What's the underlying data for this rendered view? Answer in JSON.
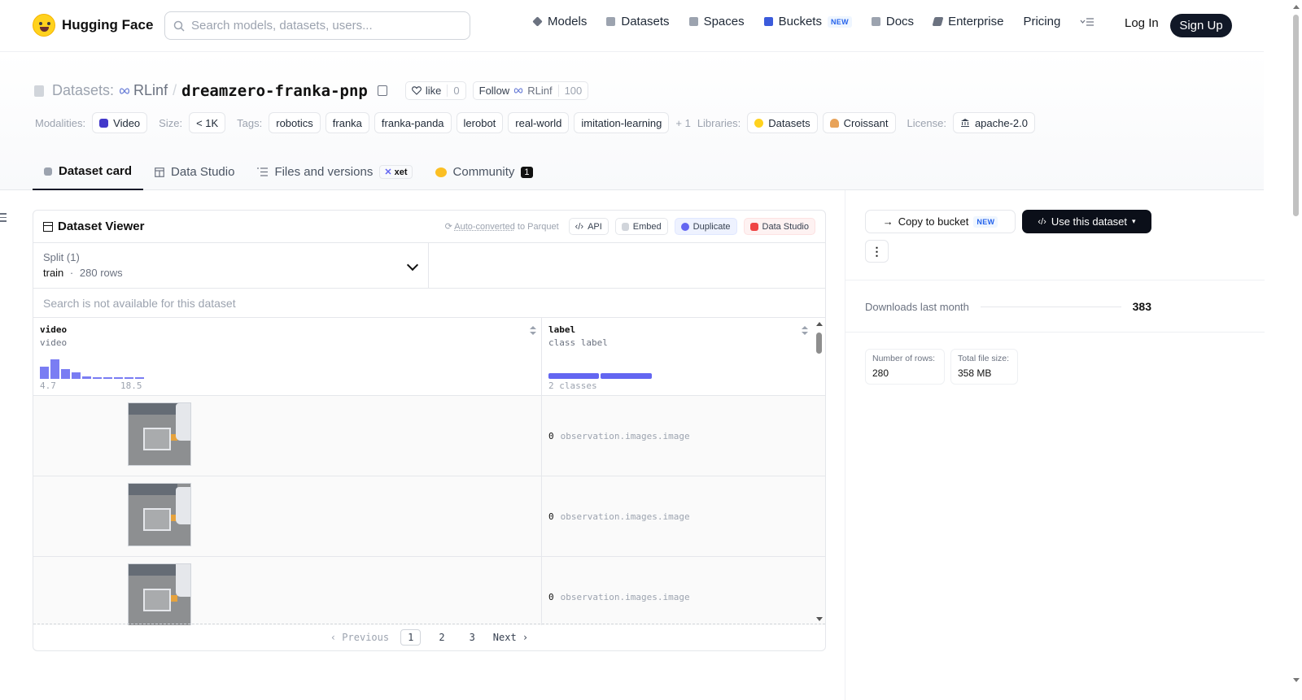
{
  "nav": {
    "brand": "Hugging Face",
    "search_placeholder": "Search models, datasets, users...",
    "items": [
      {
        "label": "Models",
        "icon": "models-icon",
        "color": "#6b7280"
      },
      {
        "label": "Datasets",
        "icon": "datasets-icon",
        "color": "#9ca3af"
      },
      {
        "label": "Spaces",
        "icon": "spaces-icon",
        "color": "#9ca3af"
      },
      {
        "label": "Buckets",
        "icon": "buckets-icon",
        "color": "#3b5bdb",
        "badge": "NEW"
      },
      {
        "label": "Docs",
        "icon": "docs-icon",
        "color": "#9ca3af"
      },
      {
        "label": "Enterprise",
        "icon": "enterprise-icon",
        "color": "#6b7280"
      },
      {
        "label": "Pricing"
      }
    ],
    "login": "Log In",
    "signup": "Sign Up"
  },
  "repo": {
    "prefix": "Datasets:",
    "org": "RLinf",
    "slash": "/",
    "name": "dreamzero-franka-pnp",
    "like_label": "like",
    "like_count": "0",
    "follow_label": "Follow",
    "follow_org": "RLinf",
    "follow_count": "100"
  },
  "meta": {
    "modalities_label": "Modalities:",
    "modality": "Video",
    "size_label": "Size:",
    "size": "< 1K",
    "tags_label": "Tags:",
    "tags": [
      "robotics",
      "franka",
      "franka-panda",
      "lerobot",
      "real-world",
      "imitation-learning"
    ],
    "tags_more": "+ 1",
    "libraries_label": "Libraries:",
    "libraries": [
      "Datasets",
      "Croissant"
    ],
    "license_label": "License:",
    "license": "apache-2.0"
  },
  "tabs": [
    {
      "label": "Dataset card",
      "active": true
    },
    {
      "label": "Data Studio"
    },
    {
      "label": "Files and versions",
      "badge": "xet"
    },
    {
      "label": "Community",
      "count": "1"
    }
  ],
  "viewer": {
    "title": "Dataset Viewer",
    "auto_prefix": "Auto-converted",
    "auto_suffix": "to Parquet",
    "buttons": [
      "API",
      "Embed",
      "Duplicate",
      "Data Studio"
    ],
    "split_label": "Split (1)",
    "split_value": "train",
    "split_sep": "·",
    "split_rows": "280 rows",
    "search_note": "Search is not available for this dataset",
    "columns": [
      {
        "name": "video",
        "type": "video",
        "hist_min": "4.7",
        "hist_max": "18.5",
        "hist": [
          0.55,
          0.85,
          0.42,
          0.28,
          0.12,
          0.08,
          0.06,
          0.05,
          0.03,
          0.04
        ]
      },
      {
        "name": "label",
        "type": "class label",
        "classes_note": "2 classes"
      }
    ],
    "rows": [
      {
        "num": "0",
        "label": "observation.images.image"
      },
      {
        "num": "0",
        "label": "observation.images.image"
      },
      {
        "num": "0",
        "label": "observation.images.image"
      }
    ],
    "pager": {
      "prev": "Previous",
      "pages": [
        "1",
        "2",
        "3"
      ],
      "current": "1",
      "next": "Next"
    }
  },
  "sidebar": {
    "copy_bucket": "Copy to bucket",
    "copy_badge": "NEW",
    "use_dataset": "Use this dataset",
    "downloads_label": "Downloads last month",
    "downloads": "383",
    "rows_label": "Number of rows:",
    "rows": "280",
    "size_label": "Total file size:",
    "size": "358 MB"
  }
}
